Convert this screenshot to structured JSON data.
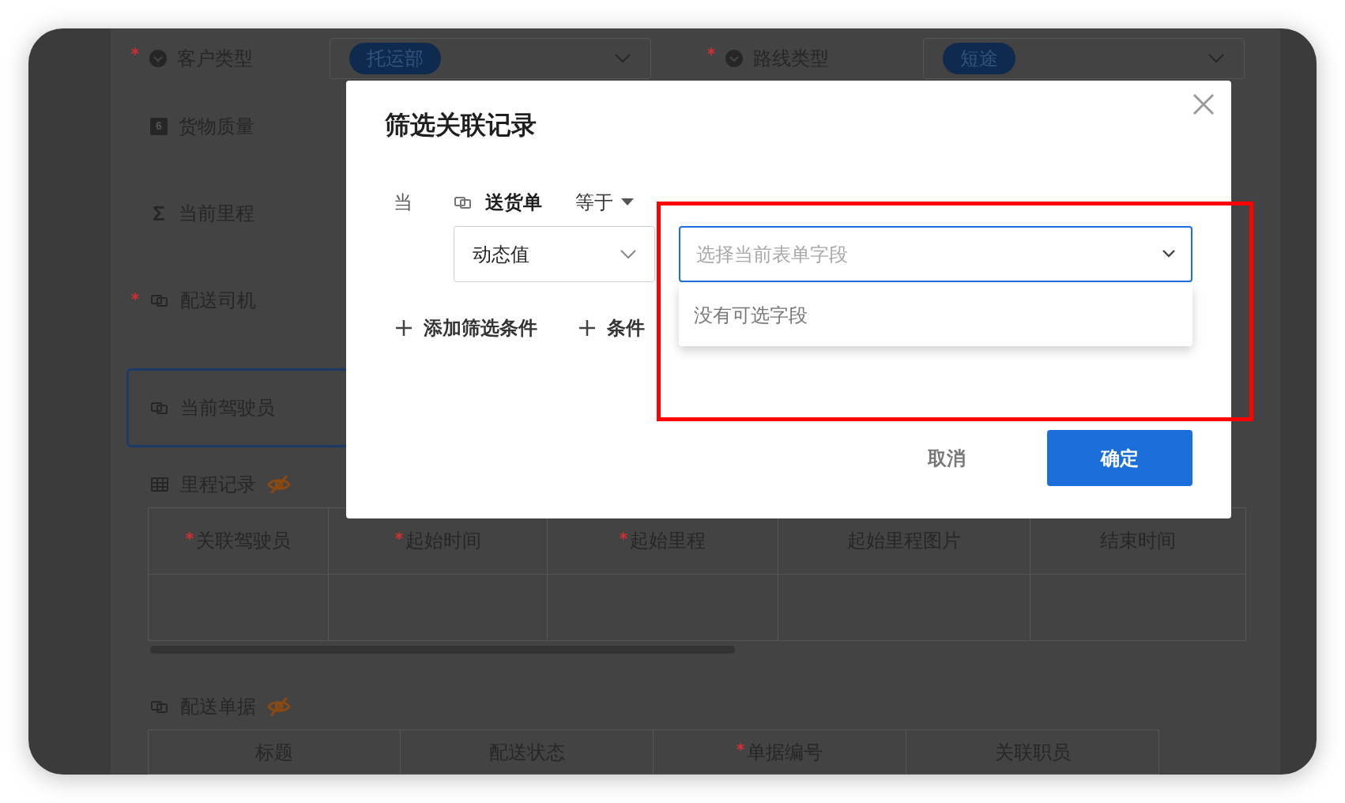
{
  "background_form": {
    "top_fields": [
      {
        "label": "客户类型",
        "required": true,
        "tag": "托运部"
      },
      {
        "label": "路线类型",
        "required": true,
        "tag": "短途"
      }
    ],
    "fields": [
      {
        "label": "货物质量",
        "required": false,
        "kind": "number",
        "icon_text": "6",
        "selected": false
      },
      {
        "label": "当前里程",
        "required": false,
        "kind": "formula",
        "icon_text": "Σ",
        "selected": false
      },
      {
        "label": "配送司机",
        "required": true,
        "kind": "link",
        "selected": false
      },
      {
        "label": "当前驾驶员",
        "required": false,
        "kind": "link",
        "selected": true
      }
    ],
    "subtables": [
      {
        "title": "里程记录",
        "kind": "table",
        "hidden": true,
        "body_row": true,
        "columns": [
          {
            "label": "关联驾驶员",
            "required": true
          },
          {
            "label": "起始时间",
            "required": true
          },
          {
            "label": "起始里程",
            "required": true
          },
          {
            "label": "起始里程图片",
            "required": false
          },
          {
            "label": "结束时间",
            "required": false
          }
        ]
      },
      {
        "title": "配送单据",
        "kind": "link",
        "hidden": true,
        "body_row": false,
        "columns": [
          {
            "label": "标题",
            "required": false
          },
          {
            "label": "配送状态",
            "required": false
          },
          {
            "label": "单据编号",
            "required": true
          },
          {
            "label": "关联职员",
            "required": false
          }
        ]
      }
    ]
  },
  "dialog": {
    "title": "筛选关联记录",
    "condition": {
      "prefix": "当",
      "field": "送货单",
      "operator": "等于",
      "value_type": "动态值",
      "value_placeholder": "选择当前表单字段",
      "dropdown_empty": "没有可选字段"
    },
    "add_actions": [
      {
        "label": "添加筛选条件"
      },
      {
        "label": "条件"
      }
    ],
    "cancel": "取消",
    "confirm": "确定"
  },
  "highlight_box": true
}
